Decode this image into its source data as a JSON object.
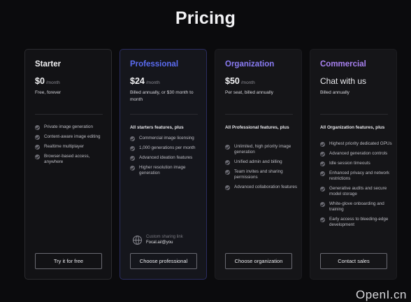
{
  "page": {
    "title": "Pricing"
  },
  "plans": [
    {
      "name": "Starter",
      "price": "$0",
      "per": "/month",
      "subtitle": "Free, forever",
      "features_heading": "",
      "features": [
        "Private image generation",
        "Content-aware image editing",
        "Realtime multiplayer",
        "Browser-based access, anywhere"
      ],
      "button": "Try it for free"
    },
    {
      "name": "Professional",
      "price": "$24",
      "per": "/month",
      "subtitle": "Billed annually, or $30 month to month",
      "features_heading": "All starters features, plus",
      "features": [
        "Commercial image licensing",
        "1,000 generations per month",
        "Advanced ideation features",
        "Higher resolution image generation"
      ],
      "link_label": "Custom sharing link",
      "link_url": "Focal.ai/@you",
      "button": "Choose professional"
    },
    {
      "name": "Organization",
      "price": "$50",
      "per": "/month",
      "subtitle": "Per seat, billed annually",
      "features_heading": "All Professional features, plus",
      "features": [
        "Unlimited, high priority image generation",
        "Unified admin and billing",
        "Team invites and sharing permissions",
        "Advanced collaboration features"
      ],
      "button": "Choose organization"
    },
    {
      "name": "Commercial",
      "price": "Chat with us",
      "subtitle": "Billed annually",
      "features_heading": "All Organization features, plus",
      "features": [
        "Highest priority dedicated GPUs",
        "Advanced generation controls",
        "Idle session timeouts",
        "Enhanced privacy and network restrictions",
        "Generative audits and secure model storage",
        "White-glove onboarding and training",
        "Early access to bleeding-edge development"
      ],
      "button": "Contact sales"
    }
  ],
  "watermark": "OpenI.cn",
  "icons": {
    "feature_check": "check-circle-icon",
    "link": "globe-icon"
  },
  "colors": {
    "starter_name": "#f2f2f4",
    "professional_name": "#5b6cf2",
    "organization_name": "#8a7cf5",
    "commercial_name": "#a982f2",
    "professional_border": "#2b2d60"
  }
}
